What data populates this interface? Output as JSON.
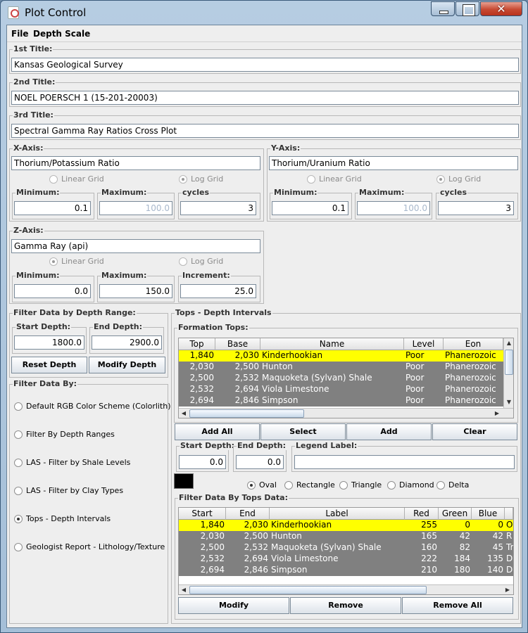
{
  "window": {
    "title": "Plot Control"
  },
  "menu": [
    {
      "label": "File"
    },
    {
      "label": "Depth Scale"
    }
  ],
  "titles": {
    "first": {
      "label": "1st Title:",
      "value": "Kansas Geological Survey"
    },
    "second": {
      "label": "2nd Title:",
      "value": "NOEL POERSCH 1 (15-201-20003)"
    },
    "third": {
      "label": "3rd Title:",
      "value": "Spectral Gamma Ray Ratios Cross Plot"
    }
  },
  "x_axis": {
    "label": "X-Axis:",
    "value": "Thorium/Potassium Ratio",
    "linear_grid": "Linear Grid",
    "log_grid": "Log Grid",
    "selected_grid": "log",
    "minimum_label": "Minimum:",
    "minimum": "0.1",
    "maximum_label": "Maximum:",
    "maximum": "100.0",
    "cycles_label": "cycles",
    "cycles": "3"
  },
  "y_axis": {
    "label": "Y-Axis:",
    "value": "Thorium/Uranium Ratio",
    "linear_grid": "Linear Grid",
    "log_grid": "Log Grid",
    "selected_grid": "log",
    "minimum_label": "Minimum:",
    "minimum": "0.1",
    "maximum_label": "Maximum:",
    "maximum": "100.0",
    "cycles_label": "cycles",
    "cycles": "3"
  },
  "z_axis": {
    "label": "Z-Axis:",
    "value": "Gamma Ray (api)",
    "linear_grid": "Linear Grid",
    "log_grid": "Log Grid",
    "selected_grid": "linear",
    "minimum_label": "Minimum:",
    "minimum": "0.0",
    "maximum_label": "Maximum:",
    "maximum": "150.0",
    "increment_label": "Increment:",
    "increment": "25.0"
  },
  "depth_range": {
    "label": "Filter Data by Depth Range:",
    "start_label": "Start Depth:",
    "start": "1800.0",
    "end_label": "End Depth:",
    "end": "2900.0",
    "reset_button": "Reset Depth",
    "modify_button": "Modify Depth"
  },
  "filter_by": {
    "label": "Filter Data By:",
    "options": [
      {
        "label": "Default RGB Color Scheme (Colorlith)",
        "selected": false
      },
      {
        "label": "Filter By Depth Ranges",
        "selected": false
      },
      {
        "label": "LAS - Filter by Shale Levels",
        "selected": false
      },
      {
        "label": "LAS - Filter by Clay Types",
        "selected": false
      },
      {
        "label": "Tops - Depth Intervals",
        "selected": true
      },
      {
        "label": "Geologist Report - Lithology/Texture",
        "selected": false
      }
    ]
  },
  "tops": {
    "label": "Tops - Depth Intervals",
    "formation_label": "Formation Tops:",
    "formation_columns": [
      "Top",
      "Base",
      "Name",
      "Level",
      "Eon"
    ],
    "formation_rows": [
      {
        "top": "1,840",
        "base": "2,030",
        "name": "Kinderhookian",
        "level": "Poor",
        "eon": "Phanerozoic",
        "selected": true
      },
      {
        "top": "2,030",
        "base": "2,500",
        "name": "Hunton",
        "level": "Poor",
        "eon": "Phanerozoic",
        "selected": false
      },
      {
        "top": "2,500",
        "base": "2,532",
        "name": "Maquoketa (Sylvan) Shale",
        "level": "Poor",
        "eon": "Phanerozoic",
        "selected": false
      },
      {
        "top": "2,532",
        "base": "2,694",
        "name": "Viola Limestone",
        "level": "Poor",
        "eon": "Phanerozoic",
        "selected": false
      },
      {
        "top": "2,694",
        "base": "2,846",
        "name": "Simpson",
        "level": "Poor",
        "eon": "Phanerozoic",
        "selected": false
      }
    ],
    "buttons": {
      "add_all": "Add All",
      "select": "Select",
      "add": "Add",
      "clear": "Clear"
    },
    "start_label": "Start Depth:",
    "start": "0.0",
    "end_label": "End Depth:",
    "end": "0.0",
    "legend_label": "Legend Label:",
    "legend_value": "",
    "swatch_color": "#000000",
    "shapes": [
      {
        "label": "Oval",
        "selected": true
      },
      {
        "label": "Rectangle",
        "selected": false
      },
      {
        "label": "Triangle",
        "selected": false
      },
      {
        "label": "Diamond",
        "selected": false
      },
      {
        "label": "Delta",
        "selected": false
      }
    ],
    "filter_label": "Filter Data By Tops Data:",
    "filter_columns": [
      "Start",
      "End",
      "Label",
      "Red",
      "Green",
      "Blue",
      ""
    ],
    "filter_rows": [
      {
        "start": "1,840",
        "end": "2,030",
        "label": "Kinderhookian",
        "red": "255",
        "green": "0",
        "blue": "0",
        "extra": "Ov",
        "selected": true
      },
      {
        "start": "2,030",
        "end": "2,500",
        "label": "Hunton",
        "red": "165",
        "green": "42",
        "blue": "42",
        "extra": "R",
        "selected": false
      },
      {
        "start": "2,500",
        "end": "2,532",
        "label": "Maquoketa (Sylvan) Shale",
        "red": "160",
        "green": "82",
        "blue": "45",
        "extra": "Tr",
        "selected": false
      },
      {
        "start": "2,532",
        "end": "2,694",
        "label": "Viola Limestone",
        "red": "222",
        "green": "184",
        "blue": "135",
        "extra": "D",
        "selected": false
      },
      {
        "start": "2,694",
        "end": "2,846",
        "label": "Simpson",
        "red": "210",
        "green": "180",
        "blue": "140",
        "extra": "D",
        "selected": false
      }
    ],
    "bottom_buttons": {
      "modify": "Modify",
      "remove": "Remove",
      "remove_all": "Remove All"
    }
  },
  "colors": {
    "selected_row": "#ffff00",
    "row_bg": "#808080",
    "close_button": "#c74a32"
  }
}
